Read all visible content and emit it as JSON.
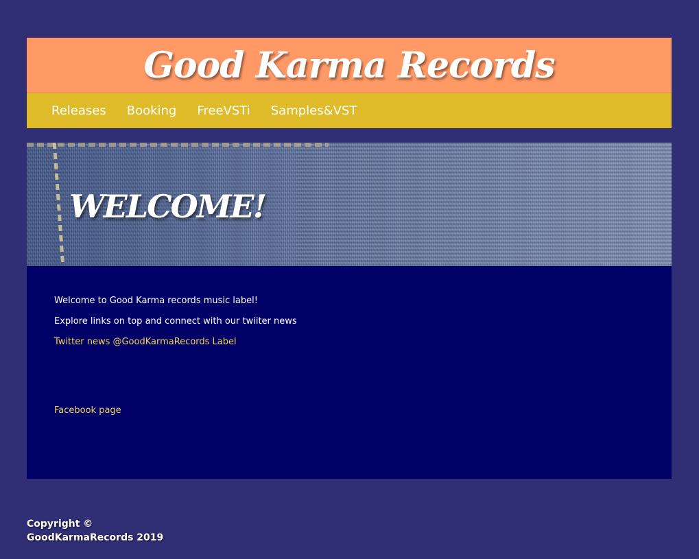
{
  "header": {
    "title": "Good Karma Records"
  },
  "nav": {
    "items": [
      {
        "label": "Releases"
      },
      {
        "label": "Booking"
      },
      {
        "label": "FreeVSTi"
      },
      {
        "label": "Samples&VST"
      }
    ]
  },
  "hero": {
    "heading": "WELCOME!"
  },
  "content": {
    "welcome_text": "Welcome to Good Karma records music label!",
    "explore_text": "Explore links on top and connect with our twiiter news",
    "twitter_link": "Twitter news @GoodKarmaRecords Label",
    "facebook_link": "Facebook page"
  },
  "footer": {
    "copyright_line1": "Copyright ©",
    "copyright_line2": "GoodKarmaRecords 2019"
  },
  "colors": {
    "page_background": "#302f76",
    "header_background": "#ff9966",
    "nav_background": "#dfba29",
    "content_background": "#000066",
    "link_color": "#f2d35b"
  }
}
